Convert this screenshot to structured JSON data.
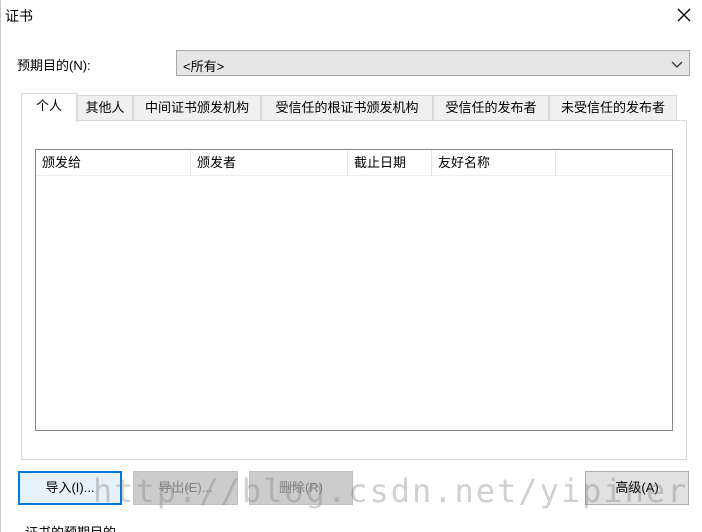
{
  "window": {
    "title": "证书"
  },
  "purpose": {
    "label": "预期目的(N):",
    "selected": "<所有>"
  },
  "tabs": [
    {
      "label": "个人",
      "active": true
    },
    {
      "label": "其他人",
      "active": false
    },
    {
      "label": "中间证书颁发机构",
      "active": false
    },
    {
      "label": "受信任的根证书颁发机构",
      "active": false
    },
    {
      "label": "受信任的发布者",
      "active": false
    },
    {
      "label": "未受信任的发布者",
      "active": false
    }
  ],
  "list": {
    "columns": [
      "颁发给",
      "颁发者",
      "截止日期",
      "友好名称"
    ],
    "rows": []
  },
  "buttons": {
    "import": "导入(I)...",
    "export": "导出(E)...",
    "remove": "删除(R)",
    "advanced": "高级(A)"
  },
  "bottom": {
    "label": "证书的预期目的"
  },
  "watermark": "http://blog.csdn.net/yipiner",
  "colors": {
    "focus_border": "#0078d7",
    "select_bg": "#e6e6e6"
  }
}
